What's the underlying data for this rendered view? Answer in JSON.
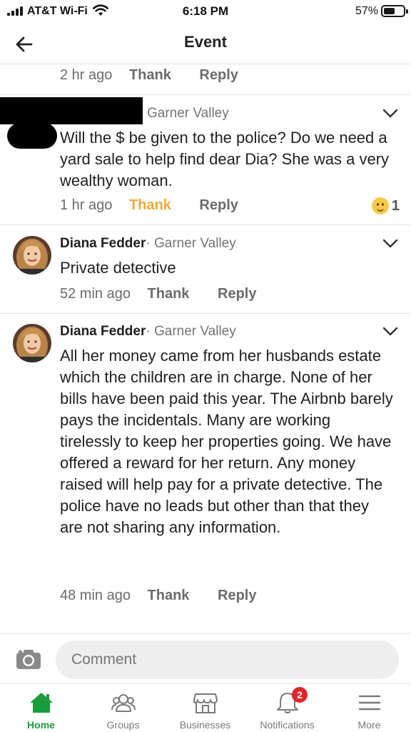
{
  "status_bar": {
    "carrier": "AT&T Wi-Fi",
    "time": "6:18 PM",
    "battery": "57%"
  },
  "header": {
    "title": "Event",
    "back_icon": "arrow-left-icon"
  },
  "comments": [
    {
      "time": "2 hr ago",
      "thank_label": "Thank",
      "reply_label": "Reply"
    },
    {
      "author_location": "Garner Valley",
      "body": "Will the $ be given to the police?  Do we need a yard sale to help find dear Dia? She was a very wealthy woman.",
      "time": "1 hr ago",
      "thank_label": "Thank",
      "reply_label": "Reply",
      "reaction_count": "1",
      "thanked_color": "#f0a93b"
    },
    {
      "author_name": "Diana Fedder",
      "author_location": "· Garner Valley",
      "body": "Private detective",
      "time": "52 min ago",
      "thank_label": "Thank",
      "reply_label": "Reply"
    },
    {
      "author_name": "Diana Fedder",
      "author_location": "· Garner Valley",
      "body": "All her money came from her husbands estate which the children are in charge. None of her bills have been paid this year.   The Airbnb barely pays the incidentals.   Many are working tirelessly to keep her properties going.  We have offered a reward for her return.   Any money raised will help pay for a private detective.  The police have no leads but other than that they are not sharing any information.",
      "time": "48 min ago",
      "thank_label": "Thank",
      "reply_label": "Reply"
    }
  ],
  "composer": {
    "placeholder": "Comment"
  },
  "tabs": [
    {
      "label": "Home",
      "icon": "home-icon",
      "active": true
    },
    {
      "label": "Groups",
      "icon": "groups-icon"
    },
    {
      "label": "Businesses",
      "icon": "storefront-icon"
    },
    {
      "label": "Notifications",
      "icon": "bell-icon",
      "badge": "2"
    },
    {
      "label": "More",
      "icon": "menu-icon"
    }
  ],
  "colors": {
    "accent_green": "#1a9c3d",
    "badge_red": "#e0262b",
    "thanked_orange": "#f0a93b"
  }
}
